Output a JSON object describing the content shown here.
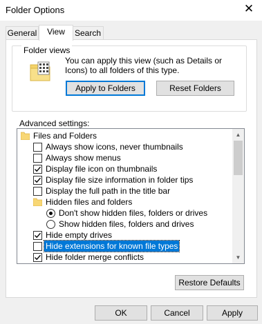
{
  "window": {
    "title": "Folder Options",
    "close_glyph": "✕"
  },
  "tabs": [
    {
      "label": "General",
      "active": false
    },
    {
      "label": "View",
      "active": true
    },
    {
      "label": "Search",
      "active": false
    }
  ],
  "folder_views": {
    "caption": "Folder views",
    "text": "You can apply this view (such as Details or Icons) to all folders of this type.",
    "apply_label": "Apply to Folders",
    "reset_label": "Reset Folders",
    "icon": "folder-grid-icon"
  },
  "advanced": {
    "label": "Advanced settings:",
    "items": [
      {
        "label": "Files and Folders",
        "kind": "folder",
        "level": 0
      },
      {
        "label": "Always show icons, never thumbnails",
        "kind": "checkbox",
        "checked": false,
        "level": 1
      },
      {
        "label": "Always show menus",
        "kind": "checkbox",
        "checked": false,
        "level": 1
      },
      {
        "label": "Display file icon on thumbnails",
        "kind": "checkbox",
        "checked": true,
        "level": 1
      },
      {
        "label": "Display file size information in folder tips",
        "kind": "checkbox",
        "checked": true,
        "level": 1
      },
      {
        "label": "Display the full path in the title bar",
        "kind": "checkbox",
        "checked": false,
        "level": 1
      },
      {
        "label": "Hidden files and folders",
        "kind": "folder",
        "level": 1
      },
      {
        "label": "Don't show hidden files, folders or drives",
        "kind": "radio",
        "checked": true,
        "level": 2
      },
      {
        "label": "Show hidden files, folders and drives",
        "kind": "radio",
        "checked": false,
        "level": 2
      },
      {
        "label": "Hide empty drives",
        "kind": "checkbox",
        "checked": true,
        "level": 1
      },
      {
        "label": "Hide extensions for known file types",
        "kind": "checkbox",
        "checked": false,
        "level": 1,
        "selected": true
      },
      {
        "label": "Hide folder merge conflicts",
        "kind": "checkbox",
        "checked": true,
        "level": 1
      }
    ]
  },
  "buttons": {
    "restore_defaults": "Restore Defaults",
    "ok": "OK",
    "cancel": "Cancel",
    "apply": "Apply"
  },
  "colors": {
    "accent": "#0078d7",
    "selection": "#0078d7"
  }
}
